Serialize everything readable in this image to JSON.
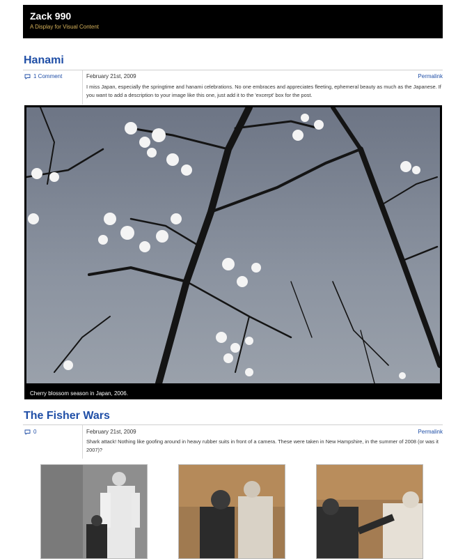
{
  "site": {
    "title": "Zack 990",
    "tagline": "A Display for Visual Content"
  },
  "posts": [
    {
      "title": "Hanami",
      "comments": "1 Comment",
      "date": "February 21st, 2009",
      "permalink": "Permalink",
      "excerpt": "I miss Japan, especially the springtime and hanami celebrations. No one embraces and appreciates fleeting, ephemeral beauty as much as the Japanese. If you want to add a description to your image like this one, just add it to the 'excerpt' box for the post.",
      "image_caption": "Cherry blossom season in Japan, 2006."
    },
    {
      "title": "The Fisher Wars",
      "comments": "0",
      "date": "February 21st, 2009",
      "permalink": "Permalink",
      "excerpt": "Shark attack! Nothing like goofing around in heavy rubber suits in front of a camera. These were taken in New Hampshire, in the summer of 2008 (or was it 2007)?"
    }
  ],
  "colors": {
    "link": "#1f4ea6",
    "header_bg": "#000000",
    "tagline": "#d6b25b"
  }
}
